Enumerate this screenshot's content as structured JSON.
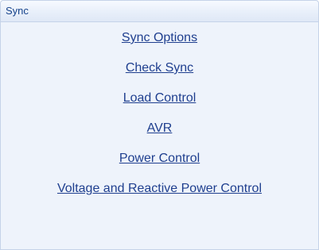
{
  "panel": {
    "title": "Sync"
  },
  "links": [
    {
      "label": "Sync Options"
    },
    {
      "label": "Check Sync"
    },
    {
      "label": "Load Control"
    },
    {
      "label": "AVR"
    },
    {
      "label": "Power Control"
    },
    {
      "label": "Voltage and Reactive Power Control"
    }
  ],
  "colors": {
    "panel_background": "#eef3fb",
    "header_text": "#15428b",
    "link_text": "#1f3f8f",
    "border": "#c5d3e8"
  }
}
